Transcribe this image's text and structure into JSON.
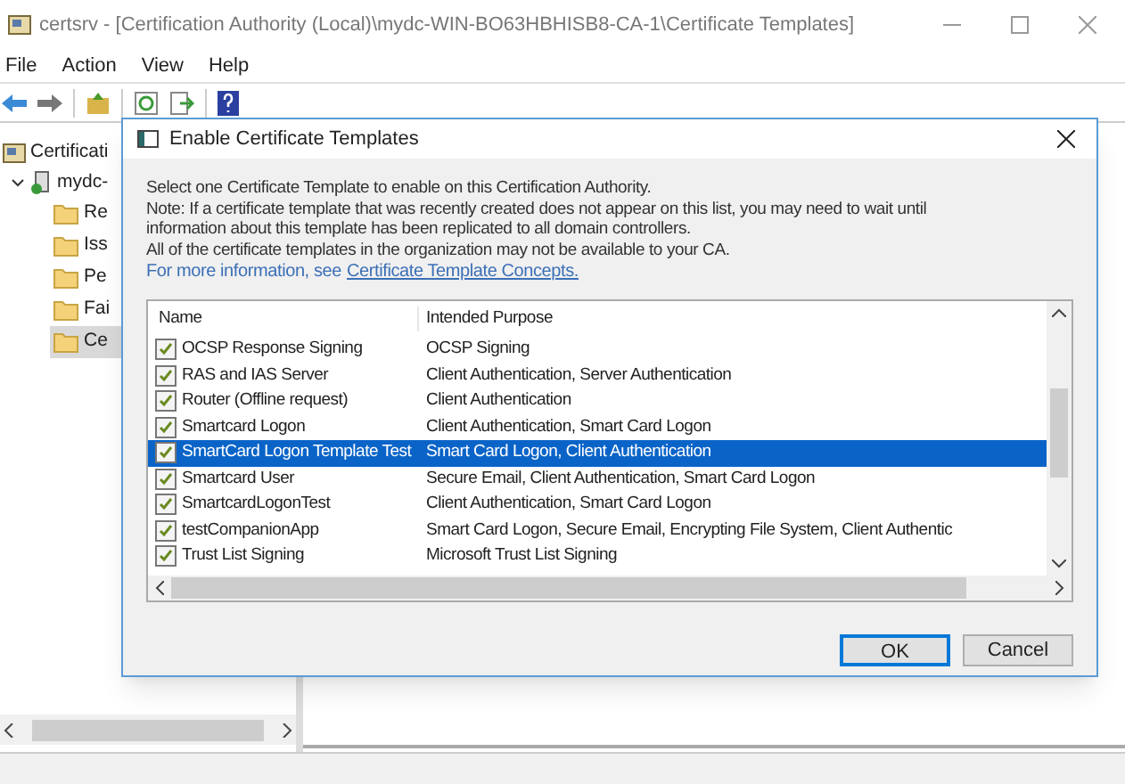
{
  "window": {
    "title": "certsrv - [Certification Authority (Local)\\mydc-WIN-BO63HBHISB8-CA-1\\Certificate Templates]"
  },
  "menu": [
    "File",
    "Action",
    "View",
    "Help"
  ],
  "tree": {
    "items": [
      {
        "label": "Certificati",
        "children": [
          {
            "label": "mydc-",
            "expanded": true,
            "children": [
              {
                "label": "Re",
                "selected": false
              },
              {
                "label": "Iss",
                "selected": false
              },
              {
                "label": "Pe",
                "selected": false
              },
              {
                "label": "Fai",
                "selected": false
              },
              {
                "label": "Ce",
                "selected": true
              }
            ]
          }
        ]
      }
    ]
  },
  "dialog": {
    "title": "Enable Certificate Templates",
    "lines": [
      "Select one Certificate Template to enable on this Certification Authority.",
      "Note: If a certificate template that was recently created does not appear on this list, you may need to wait until",
      "information about this template has been replicated to all domain controllers.",
      "All of the certificate templates in the organization may not be available to your CA."
    ],
    "more_info": {
      "text": "For more information, see",
      "link": "Certificate Template Concepts."
    },
    "list": {
      "columns": [
        "Name",
        "Intended Purpose"
      ],
      "rows": [
        {
          "name": "OCSP Response Signing",
          "purpose": "OCSP Signing",
          "selected": false
        },
        {
          "name": "RAS and IAS Server",
          "purpose": "Client Authentication, Server Authentication",
          "selected": false
        },
        {
          "name": "Router (Offline request)",
          "purpose": "Client Authentication",
          "selected": false
        },
        {
          "name": "Smartcard Logon",
          "purpose": "Client Authentication, Smart Card Logon",
          "selected": false
        },
        {
          "name": "SmartCard Logon Template Test",
          "purpose": "Smart Card Logon, Client Authentication",
          "selected": true
        },
        {
          "name": "Smartcard User",
          "purpose": "Secure Email, Client Authentication, Smart Card Logon",
          "selected": false
        },
        {
          "name": "SmartcardLogonTest",
          "purpose": "Client Authentication, Smart Card Logon",
          "selected": false
        },
        {
          "name": "testCompanionApp",
          "purpose": "Smart Card Logon, Secure Email, Encrypting File System, Client Authentic",
          "selected": false
        },
        {
          "name": "Trust List Signing",
          "purpose": "Microsoft Trust List Signing",
          "selected": false
        }
      ]
    },
    "buttons": [
      {
        "label": "OK",
        "default": true
      },
      {
        "label": "Cancel",
        "default": false
      }
    ]
  }
}
